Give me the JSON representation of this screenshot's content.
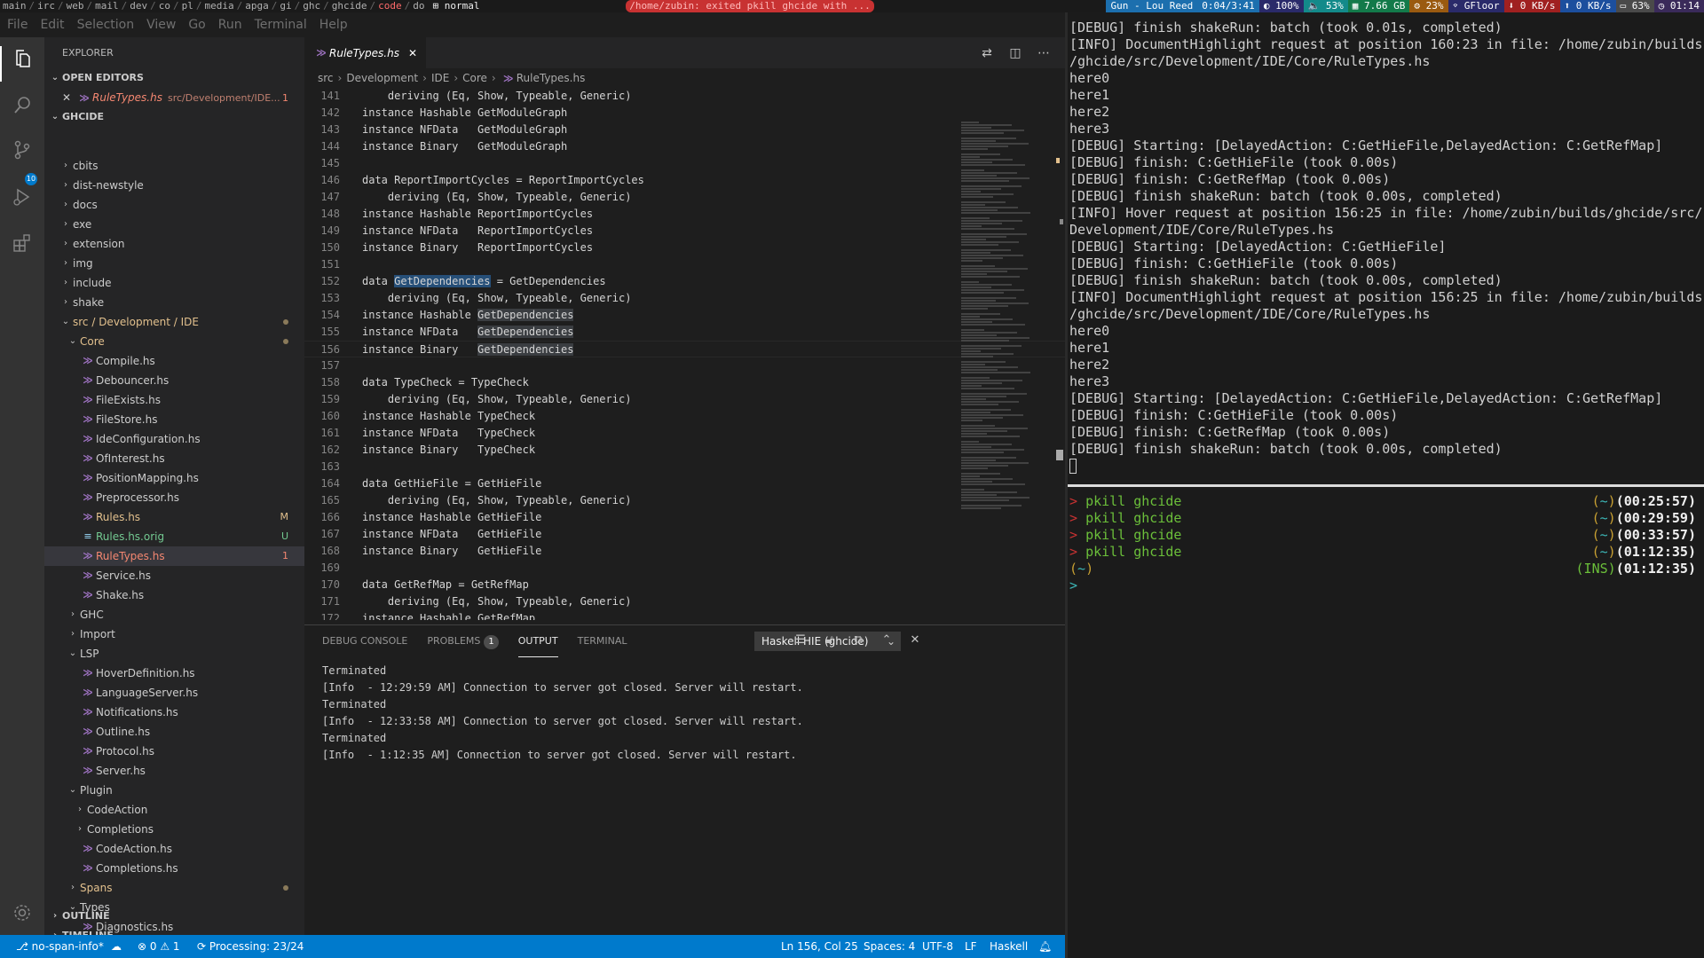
{
  "wm_bar": {
    "workspaces": [
      "main",
      "irc",
      "web",
      "mail",
      "dev",
      "co",
      "pl",
      "media",
      "apga",
      "gi",
      "ghc",
      "ghcide",
      "code",
      "do"
    ],
    "active_workspace": "code",
    "mode": "normal",
    "notification": "/home/zubin: exited pkill ghcide with ...",
    "status": {
      "music": "Gun - Lou Reed",
      "media_time": "0:04/3:41",
      "brightness": "100%",
      "volume": "53%",
      "memory": "7.66 GB",
      "cpu": "23%",
      "wifi": "GFloor",
      "down": "0 KB/s",
      "up": "0 KB/s",
      "battery": "63%",
      "clock": "01:14"
    }
  },
  "menubar": [
    "File",
    "Edit",
    "Selection",
    "View",
    "Go",
    "Run",
    "Terminal",
    "Help"
  ],
  "activity_bar": {
    "scm_badge": "10"
  },
  "sidebar": {
    "title": "EXPLORER",
    "open_editors_label": "OPEN EDITORS",
    "open_editor": {
      "name": "RuleTypes.hs",
      "path": "src/Development/IDE...",
      "count": "1"
    },
    "project_label": "GHCIDE",
    "tree": [
      {
        "label": "cbits",
        "type": "folder",
        "depth": 1
      },
      {
        "label": "dist-newstyle",
        "type": "folder",
        "depth": 1
      },
      {
        "label": "docs",
        "type": "folder",
        "depth": 1
      },
      {
        "label": "exe",
        "type": "folder",
        "depth": 1
      },
      {
        "label": "extension",
        "type": "folder",
        "depth": 1
      },
      {
        "label": "img",
        "type": "folder",
        "depth": 1
      },
      {
        "label": "include",
        "type": "folder",
        "depth": 1
      },
      {
        "label": "shake",
        "type": "folder",
        "depth": 1
      },
      {
        "label": "src / Development / IDE",
        "type": "folder-open",
        "depth": 1,
        "git": "mod-dot"
      },
      {
        "label": "Core",
        "type": "folder-open",
        "depth": 2,
        "git": "mod-dot"
      },
      {
        "label": "Compile.hs",
        "type": "hs",
        "depth": 3
      },
      {
        "label": "Debouncer.hs",
        "type": "hs",
        "depth": 3
      },
      {
        "label": "FileExists.hs",
        "type": "hs",
        "depth": 3
      },
      {
        "label": "FileStore.hs",
        "type": "hs",
        "depth": 3
      },
      {
        "label": "IdeConfiguration.hs",
        "type": "hs",
        "depth": 3
      },
      {
        "label": "OfInterest.hs",
        "type": "hs",
        "depth": 3
      },
      {
        "label": "PositionMapping.hs",
        "type": "hs",
        "depth": 3
      },
      {
        "label": "Preprocessor.hs",
        "type": "hs",
        "depth": 3
      },
      {
        "label": "Rules.hs",
        "type": "hs",
        "depth": 3,
        "git": "M"
      },
      {
        "label": "Rules.hs.orig",
        "type": "txt",
        "depth": 3,
        "git": "U"
      },
      {
        "label": "RuleTypes.hs",
        "type": "hs",
        "depth": 3,
        "git": "1",
        "selected": true
      },
      {
        "label": "Service.hs",
        "type": "hs",
        "depth": 3
      },
      {
        "label": "Shake.hs",
        "type": "hs",
        "depth": 3
      },
      {
        "label": "GHC",
        "type": "folder",
        "depth": 2
      },
      {
        "label": "Import",
        "type": "folder",
        "depth": 2
      },
      {
        "label": "LSP",
        "type": "folder-open",
        "depth": 2
      },
      {
        "label": "HoverDefinition.hs",
        "type": "hs",
        "depth": 3
      },
      {
        "label": "LanguageServer.hs",
        "type": "hs",
        "depth": 3
      },
      {
        "label": "Notifications.hs",
        "type": "hs",
        "depth": 3
      },
      {
        "label": "Outline.hs",
        "type": "hs",
        "depth": 3
      },
      {
        "label": "Protocol.hs",
        "type": "hs",
        "depth": 3
      },
      {
        "label": "Server.hs",
        "type": "hs",
        "depth": 3
      },
      {
        "label": "Plugin",
        "type": "folder-open",
        "depth": 2
      },
      {
        "label": "CodeAction",
        "type": "folder",
        "depth": 3
      },
      {
        "label": "Completions",
        "type": "folder",
        "depth": 3
      },
      {
        "label": "CodeAction.hs",
        "type": "hs",
        "depth": 3
      },
      {
        "label": "Completions.hs",
        "type": "hs",
        "depth": 3
      },
      {
        "label": "Spans",
        "type": "folder",
        "depth": 2,
        "git": "mod-dot"
      },
      {
        "label": "Types",
        "type": "folder-open",
        "depth": 2
      },
      {
        "label": "Diagnostics.hs",
        "type": "hs",
        "depth": 3
      }
    ],
    "outline_label": "OUTLINE",
    "timeline_label": "TIMELINE"
  },
  "editor": {
    "tab": "RuleTypes.hs",
    "breadcrumb": [
      "src",
      "Development",
      "IDE",
      "Core",
      "RuleTypes.hs"
    ],
    "lines": [
      {
        "n": "141",
        "t": "    deriving (Eq, Show, Typeable, Generic)"
      },
      {
        "n": "142",
        "t": "instance Hashable GetModuleGraph"
      },
      {
        "n": "143",
        "t": "instance NFData   GetModuleGraph"
      },
      {
        "n": "144",
        "t": "instance Binary   GetModuleGraph"
      },
      {
        "n": "145",
        "t": ""
      },
      {
        "n": "146",
        "t": "data ReportImportCycles = ReportImportCycles"
      },
      {
        "n": "147",
        "t": "    deriving (Eq, Show, Typeable, Generic)"
      },
      {
        "n": "148",
        "t": "instance Hashable ReportImportCycles"
      },
      {
        "n": "149",
        "t": "instance NFData   ReportImportCycles"
      },
      {
        "n": "150",
        "t": "instance Binary   ReportImportCycles"
      },
      {
        "n": "151",
        "t": ""
      },
      {
        "n": "152",
        "t": "data GetDependencies = GetDependencies",
        "hl_sel": "GetDependencies"
      },
      {
        "n": "153",
        "t": "    deriving (Eq, Show, Typeable, Generic)"
      },
      {
        "n": "154",
        "t": "instance Hashable GetDependencies",
        "hl": "GetDependencies"
      },
      {
        "n": "155",
        "t": "instance NFData   GetDependencies",
        "hl": "GetDependencies"
      },
      {
        "n": "156",
        "t": "instance Binary   GetDependencies",
        "hl": "GetDependencies",
        "current": true
      },
      {
        "n": "157",
        "t": ""
      },
      {
        "n": "158",
        "t": "data TypeCheck = TypeCheck"
      },
      {
        "n": "159",
        "t": "    deriving (Eq, Show, Typeable, Generic)"
      },
      {
        "n": "160",
        "t": "instance Hashable TypeCheck"
      },
      {
        "n": "161",
        "t": "instance NFData   TypeCheck"
      },
      {
        "n": "162",
        "t": "instance Binary   TypeCheck"
      },
      {
        "n": "163",
        "t": ""
      },
      {
        "n": "164",
        "t": "data GetHieFile = GetHieFile"
      },
      {
        "n": "165",
        "t": "    deriving (Eq, Show, Typeable, Generic)"
      },
      {
        "n": "166",
        "t": "instance Hashable GetHieFile"
      },
      {
        "n": "167",
        "t": "instance NFData   GetHieFile"
      },
      {
        "n": "168",
        "t": "instance Binary   GetHieFile"
      },
      {
        "n": "169",
        "t": ""
      },
      {
        "n": "170",
        "t": "data GetRefMap = GetRefMap"
      },
      {
        "n": "171",
        "t": "    deriving (Eq, Show, Typeable, Generic)"
      },
      {
        "n": "172",
        "t": "instance Hashable GetRefMap"
      }
    ]
  },
  "panel": {
    "tabs": [
      "DEBUG CONSOLE",
      "PROBLEMS",
      "OUTPUT",
      "TERMINAL"
    ],
    "problems_count": "1",
    "active_tab": "OUTPUT",
    "channel": "Haskell HIE (ghcide)",
    "output": [
      "Terminated",
      "[Info  - 12:29:59 AM] Connection to server got closed. Server will restart.",
      "Terminated",
      "[Info  - 12:33:58 AM] Connection to server got closed. Server will restart.",
      "Terminated",
      "[Info  - 1:12:35 AM] Connection to server got closed. Server will restart."
    ]
  },
  "statusbar": {
    "branch": "no-span-info*",
    "errors": "0",
    "warnings": "1",
    "processing": "Processing: 23/24",
    "position": "Ln 156, Col 25",
    "spaces": "Spaces: 4",
    "encoding": "UTF-8",
    "eol": "LF",
    "language": "Haskell"
  },
  "terminal": {
    "log": [
      "[DEBUG] finish shakeRun: batch (took 0.01s, completed)",
      "[INFO] DocumentHighlight request at position 160:23 in file: /home/zubin/builds",
      "/ghcide/src/Development/IDE/Core/RuleTypes.hs",
      "here0",
      "here1",
      "here2",
      "here3",
      "[DEBUG] Starting: [DelayedAction: C:GetHieFile,DelayedAction: C:GetRefMap]",
      "[DEBUG] finish: C:GetHieFile (took 0.00s)",
      "[DEBUG] finish: C:GetRefMap (took 0.00s)",
      "[DEBUG] finish shakeRun: batch (took 0.00s, completed)",
      "[INFO] Hover request at position 156:25 in file: /home/zubin/builds/ghcide/src/",
      "Development/IDE/Core/RuleTypes.hs",
      "[DEBUG] Starting: [DelayedAction: C:GetHieFile]",
      "[DEBUG] finish: C:GetHieFile (took 0.00s)",
      "[DEBUG] finish shakeRun: batch (took 0.00s, completed)",
      "[INFO] DocumentHighlight request at position 156:25 in file: /home/zubin/builds",
      "/ghcide/src/Development/IDE/Core/RuleTypes.hs",
      "here0",
      "here1",
      "here2",
      "here3",
      "[DEBUG] Starting: [DelayedAction: C:GetHieFile,DelayedAction: C:GetRefMap]",
      "[DEBUG] finish: C:GetHieFile (took 0.00s)",
      "[DEBUG] finish: C:GetRefMap (took 0.00s)",
      "[DEBUG] finish shakeRun: batch (took 0.00s, completed)"
    ],
    "history": [
      {
        "cmd": "pkill ghcide",
        "time": "00:25:57"
      },
      {
        "cmd": "pkill ghcide",
        "time": "00:29:59"
      },
      {
        "cmd": "pkill ghcide",
        "time": "00:33:57"
      },
      {
        "cmd": "pkill ghcide",
        "time": "01:12:35"
      }
    ],
    "prompt_dir": "~",
    "prompt_mode": "INS",
    "prompt_time": "01:12:35"
  }
}
